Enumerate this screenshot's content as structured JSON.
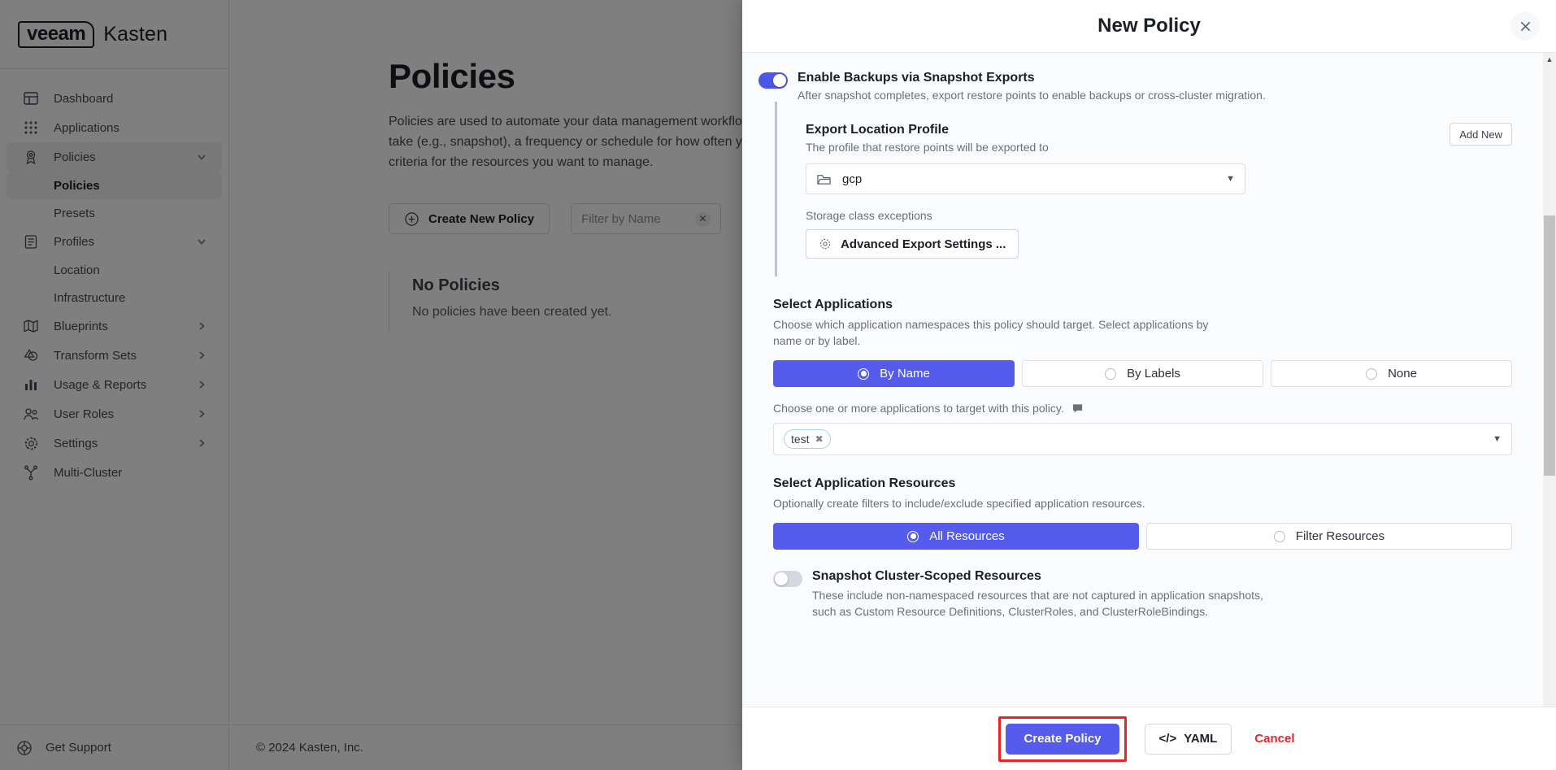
{
  "brand": {
    "veeam": "veeam",
    "kasten": "Kasten"
  },
  "sidebar": {
    "items": [
      {
        "label": "Dashboard",
        "icon": "dashboard-icon",
        "chevron": ""
      },
      {
        "label": "Applications",
        "icon": "apps-grid-icon",
        "chevron": ""
      },
      {
        "label": "Policies",
        "icon": "policy-badge-icon",
        "chevron": "chevron-down"
      },
      {
        "label": "Profiles",
        "icon": "document-icon",
        "chevron": "chevron-down"
      },
      {
        "label": "Blueprints",
        "icon": "map-icon",
        "chevron": "chevron-right"
      },
      {
        "label": "Transform Sets",
        "icon": "transform-icon",
        "chevron": "chevron-right"
      },
      {
        "label": "Usage & Reports",
        "icon": "bar-chart-icon",
        "chevron": "chevron-right"
      },
      {
        "label": "User Roles",
        "icon": "users-icon",
        "chevron": "chevron-right"
      },
      {
        "label": "Settings",
        "icon": "gear-icon",
        "chevron": "chevron-right"
      },
      {
        "label": "Multi-Cluster",
        "icon": "cluster-icon",
        "chevron": ""
      }
    ],
    "policies_sub": [
      {
        "label": "Policies",
        "selected": true
      },
      {
        "label": "Presets",
        "selected": false
      }
    ],
    "profiles_sub": [
      {
        "label": "Location",
        "selected": false
      },
      {
        "label": "Infrastructure",
        "selected": false
      }
    ],
    "support": {
      "label": "Get Support",
      "icon": "lifebuoy-icon"
    }
  },
  "page": {
    "title": "Policies",
    "description": "Policies are used to automate your data management workflows. To achieve this, policies combine actions you want to take (e.g., snapshot), a frequency or schedule for how often you want to take that action, and label-based selection criteria for the resources you want to manage.",
    "create_button": "Create New Policy",
    "create_icon": "plus-circle-icon",
    "filter_placeholder": "Filter by Name",
    "filter_clear_icon": "close-icon",
    "empty_title": "No Policies",
    "empty_subtitle": "No policies have been created yet.",
    "footer_copyright": "© 2024 Kasten, Inc."
  },
  "modal": {
    "title": "New Policy",
    "close_icon": "close-icon",
    "export_section": {
      "toggle_state": "on",
      "title": "Enable Backups via Snapshot Exports",
      "description": "After snapshot completes, export restore points to enable backups or cross-cluster migration.",
      "profile_title": "Export Location Profile",
      "profile_subtitle": "The profile that restore points will be exported to",
      "add_new_label": "Add New",
      "profile_value": "gcp",
      "profile_icon": "folder-icon",
      "caret_icon": "chevron-down-icon",
      "storage_class_label": "Storage class exceptions",
      "advanced_button": "Advanced Export Settings ...",
      "advanced_icon": "gear-icon"
    },
    "select_applications": {
      "title": "Select Applications",
      "description": "Choose which application namespaces this policy should target. Select applications by name or by label.",
      "options": [
        {
          "label": "By Name",
          "selected": true
        },
        {
          "label": "By Labels",
          "selected": false
        },
        {
          "label": "None",
          "selected": false
        }
      ],
      "hint": "Choose one or more applications to target with this policy.",
      "hint_icon": "comment-icon",
      "chips": [
        {
          "label": "test",
          "remove_icon": "close-icon"
        }
      ],
      "caret_icon": "chevron-down-icon"
    },
    "select_resources": {
      "title": "Select Application Resources",
      "description": "Optionally create filters to include/exclude specified application resources.",
      "options": [
        {
          "label": "All Resources",
          "selected": true
        },
        {
          "label": "Filter Resources",
          "selected": false
        }
      ]
    },
    "cluster_scoped": {
      "toggle_state": "off",
      "title": "Snapshot Cluster-Scoped Resources",
      "description": "These include non-namespaced resources that are not captured in application snapshots, such as Custom Resource Definitions, ClusterRoles, and ClusterRoleBindings."
    },
    "footer": {
      "create_label": "Create Policy",
      "yaml_label": "YAML",
      "yaml_icon": "code-icon",
      "cancel_label": "Cancel",
      "highlight_color": "#ee2222"
    },
    "scrollbar": {
      "up_arrow_icon": "triangle-up-icon"
    }
  },
  "colors": {
    "accent": "#545bed",
    "toggle_on": "#4e56e6",
    "danger": "#e0282e",
    "highlight": "#ee2222",
    "section_accent_bar": "#b9bdf2"
  }
}
